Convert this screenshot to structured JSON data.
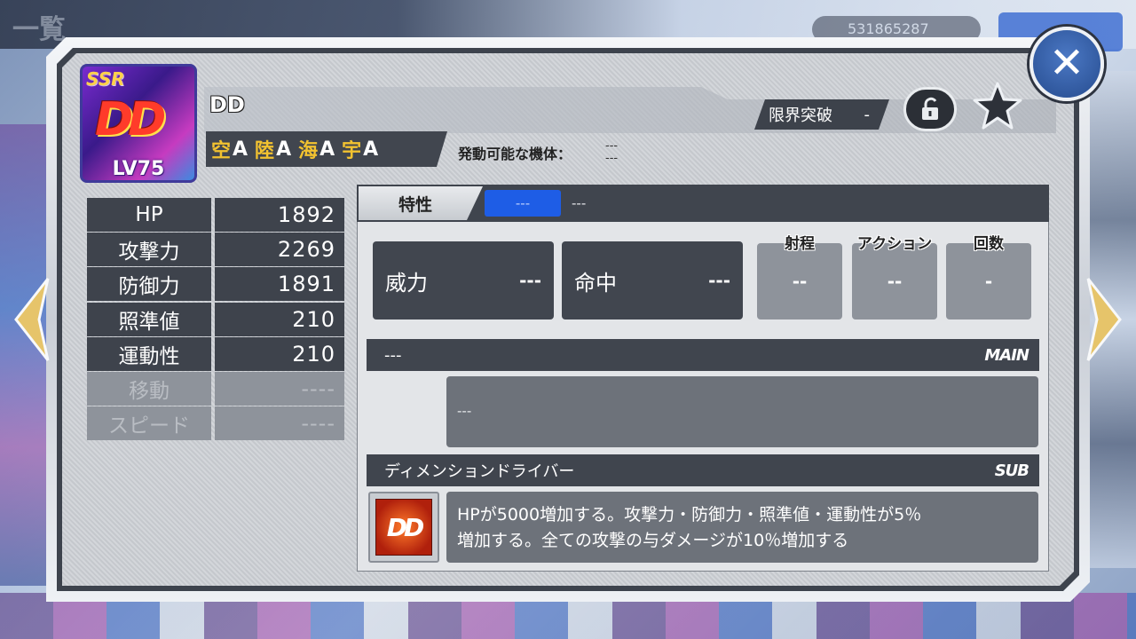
{
  "background": {
    "back_label": "一覧",
    "currency": "531865287"
  },
  "card": {
    "rarity": "SSR",
    "emblem_text": "DD",
    "level": "LV75"
  },
  "unit": {
    "name": "DD",
    "terrain": [
      {
        "key": "空",
        "grade": "A"
      },
      {
        "key": "陸",
        "grade": "A"
      },
      {
        "key": "海",
        "grade": "A"
      },
      {
        "key": "宇",
        "grade": "A"
      }
    ],
    "compat_label": "発動可能な機体：",
    "compat_values": [
      "---",
      "---"
    ],
    "limit_label": "限界突破",
    "limit_value": "-"
  },
  "stats": [
    {
      "label": "HP",
      "value": "1892",
      "enabled": true
    },
    {
      "label": "攻撃力",
      "value": "2269",
      "enabled": true
    },
    {
      "label": "防御力",
      "value": "1891",
      "enabled": true
    },
    {
      "label": "照準値",
      "value": "210",
      "enabled": true
    },
    {
      "label": "運動性",
      "value": "210",
      "enabled": true
    },
    {
      "label": "移動",
      "value": "----",
      "enabled": false
    },
    {
      "label": "スピード",
      "value": "----",
      "enabled": false
    }
  ],
  "weapon": {
    "tab_label": "特性",
    "chip_value": "---",
    "name_value": "---",
    "power_label": "威力",
    "power_value": "---",
    "accuracy_label": "命中",
    "accuracy_value": "---",
    "range_label": "射程",
    "range_value": "--",
    "action_label": "アクション",
    "action_value": "--",
    "count_label": "回数",
    "count_value": "-"
  },
  "main_ability": {
    "name": "---",
    "tag": "MAIN",
    "description": "---"
  },
  "sub_ability": {
    "name": "ディメンションドライバー",
    "tag": "SUB",
    "icon_text": "DD",
    "description_line1": "HPが5000増加する。攻撃力・防御力・照準値・運動性が5％",
    "description_line2": "増加する。全ての攻撃の与ダメージが10％増加する"
  },
  "colors": {
    "accent_blue": "#1e5de6",
    "close_button": "#3a67b5",
    "terrain_key": "#f2c230",
    "panel_dark": "#40454e"
  },
  "icons": [
    "close-icon",
    "lock-open-icon",
    "star-icon",
    "arrow-left-icon",
    "arrow-right-icon"
  ]
}
